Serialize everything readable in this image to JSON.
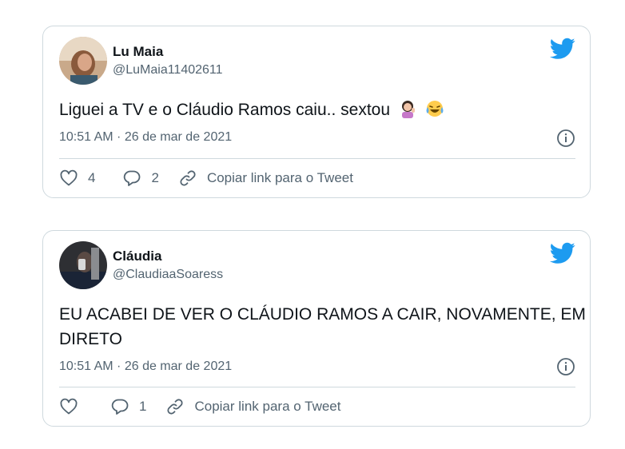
{
  "tweets": [
    {
      "name": "Lu Maia",
      "handle": "@LuMaia11402611",
      "text": "Liguei a TV e o Cláudio Ramos caiu.. sextou",
      "emojis": [
        "woman-tipping-hand-emoji",
        "tears-of-joy-emoji"
      ],
      "timestamp": "10:51 AM · 26 de mar de 2021",
      "likes": "4",
      "replies": "2",
      "copy_link_label": "Copiar link para o Tweet"
    },
    {
      "name": "Cláudia",
      "handle": "@ClaudiaaSoaress",
      "text": "EU ACABEI DE VER O CLÁUDIO RAMOS A CAIR, NOVAMENTE, EM DIRETO",
      "timestamp": "10:51 AM · 26 de mar de 2021",
      "likes": "",
      "replies": "1",
      "copy_link_label": "Copiar link para o Tweet"
    }
  ],
  "colors": {
    "brand": "#1d9bf0",
    "text": "#0f1419",
    "muted": "#536471",
    "border": "#cfd9de"
  }
}
